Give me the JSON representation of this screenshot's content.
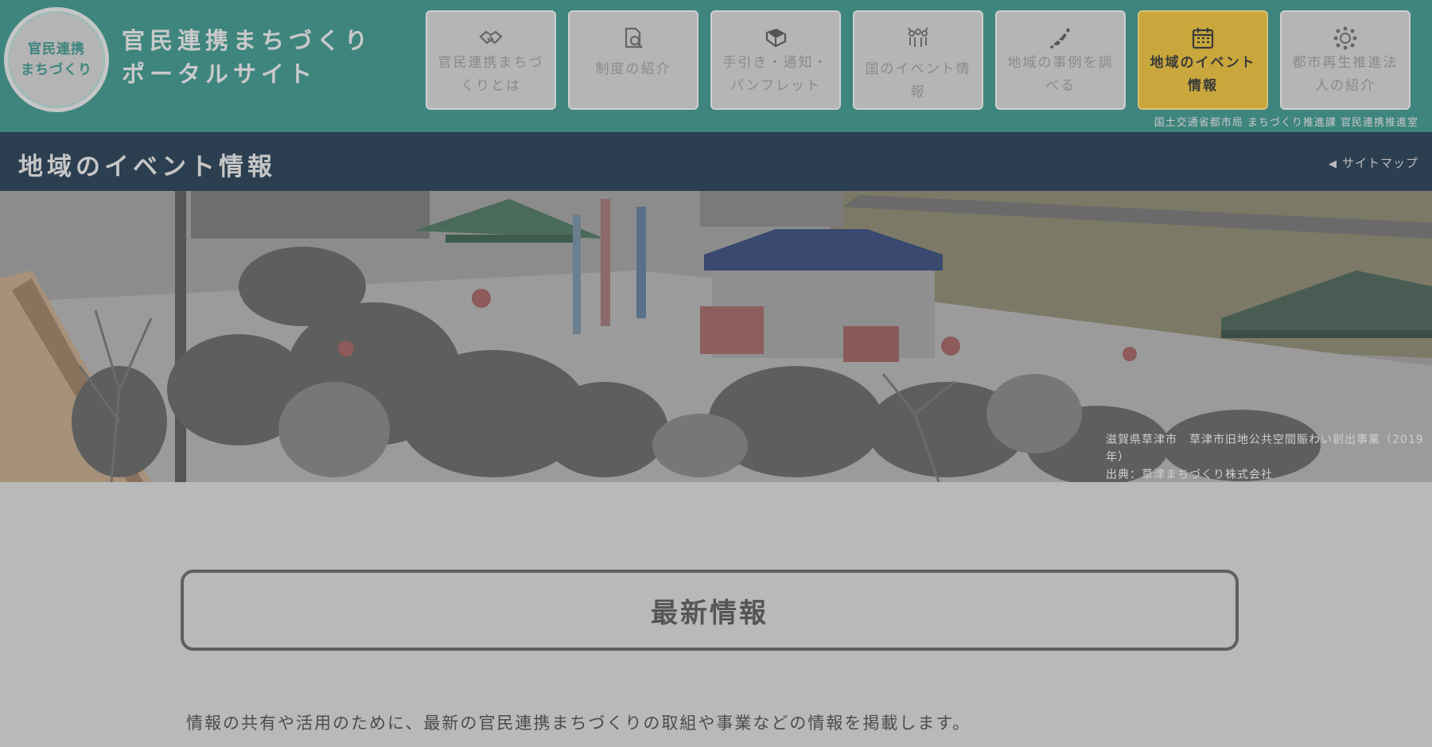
{
  "logo": {
    "line1": "官民連携",
    "line2": "まちづくり"
  },
  "site_title": {
    "line1": "官民連携まちづくり",
    "line2": "ポータルサイト"
  },
  "nav": [
    {
      "label": "官民連携まちづくりとは",
      "icon": "handshake-icon",
      "active": false
    },
    {
      "label": "制度の紹介",
      "icon": "document-search-icon",
      "active": false
    },
    {
      "label": "手引き・通知・パンフレット",
      "icon": "book-icon",
      "active": false
    },
    {
      "label": "国のイベント情報",
      "icon": "people-icon",
      "active": false
    },
    {
      "label": "地域の事例を調べる",
      "icon": "japan-map-icon",
      "active": false
    },
    {
      "label": "地域のイベント情報",
      "icon": "calendar-icon",
      "active": true
    },
    {
      "label": "都市再生推進法人の紹介",
      "icon": "network-icon",
      "active": false
    }
  ],
  "ministry": "国土交通省都市局 まちづくり推進課 官民連携推進室",
  "page_title": "地域のイベント情報",
  "sitemap": "サイトマップ",
  "hero_caption": {
    "line1": "滋賀県草津市　草津市旧地公共空間賑わい創出事業（2019年）",
    "line2": "出典：草津まちづくり株式会社"
  },
  "news_heading": "最新情報",
  "intro_text": "情報の共有や活用のために、最新の官民連携まちづくりの取組や事業などの情報を掲載します。",
  "colors": {
    "header": "#3e857e",
    "titlebar": "#2c3f51",
    "active_nav": "#c9a73c",
    "background": "#b9b9b9"
  }
}
